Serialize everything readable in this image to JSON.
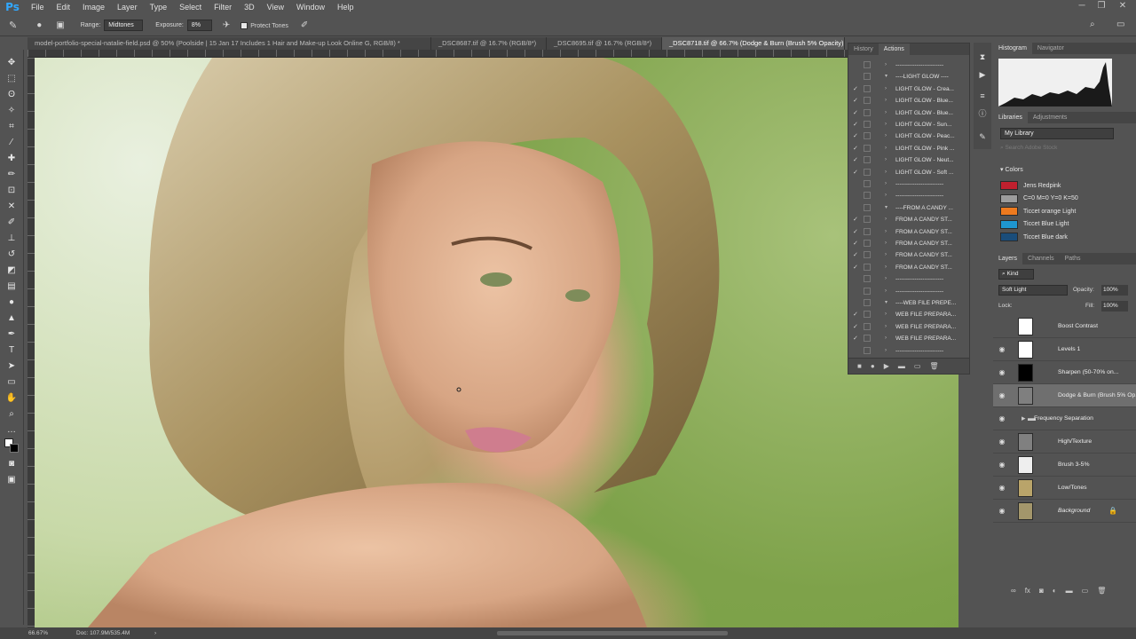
{
  "app": {
    "logo": "Ps"
  },
  "menu": [
    "File",
    "Edit",
    "Image",
    "Layer",
    "Type",
    "Select",
    "Filter",
    "3D",
    "View",
    "Window",
    "Help"
  ],
  "options": {
    "range_label": "Range:",
    "range_value": "Midtones",
    "exposure_label": "Exposure:",
    "exposure_value": "8%",
    "protect_tones": "Protect Tones"
  },
  "tabs": [
    {
      "label": "model-portfolio-special-natalie-field.psd @ 50% (Poolside | 15 Jan 17  Includes 1 Hair and Make-up Look Online G, RGB/8) *"
    },
    {
      "label": "_DSC8687.tif @ 16.7% (RGB/8*)"
    },
    {
      "label": "_DSC8695.tif @ 16.7% (RGB/8*)"
    },
    {
      "label": "_DSC8718.tif @ 66.7% (Dodge & Burn (Brush 5% Opacity), RGB/16*)"
    }
  ],
  "actions": {
    "tab_history": "History",
    "tab_actions": "Actions",
    "rows": [
      {
        "check": "",
        "label": "-------------------------",
        "open": false
      },
      {
        "check": "",
        "label": "----LIGHT GLOW ----",
        "open": true
      },
      {
        "check": "✓",
        "label": "LIGHT GLOW - Crea...",
        "open": false
      },
      {
        "check": "✓",
        "label": "LIGHT GLOW - Blue...",
        "open": false
      },
      {
        "check": "✓",
        "label": "LIGHT GLOW - Blue...",
        "open": false
      },
      {
        "check": "✓",
        "label": "LIGHT GLOW - Sun...",
        "open": false
      },
      {
        "check": "✓",
        "label": "LIGHT GLOW - Peac...",
        "open": false
      },
      {
        "check": "✓",
        "label": "LIGHT GLOW - Pink ...",
        "open": false
      },
      {
        "check": "✓",
        "label": "LIGHT GLOW - Neut...",
        "open": false
      },
      {
        "check": "✓",
        "label": "LIGHT GLOW - Soft ...",
        "open": false
      },
      {
        "check": "",
        "label": "-------------------------",
        "open": false
      },
      {
        "check": "",
        "label": "-------------------------",
        "open": false
      },
      {
        "check": "",
        "label": "----FROM A CANDY ...",
        "open": true
      },
      {
        "check": "✓",
        "label": "FROM A CANDY ST...",
        "open": false
      },
      {
        "check": "✓",
        "label": "FROM A CANDY ST...",
        "open": false
      },
      {
        "check": "✓",
        "label": "FROM A CANDY ST...",
        "open": false
      },
      {
        "check": "✓",
        "label": "FROM A CANDY ST...",
        "open": false
      },
      {
        "check": "✓",
        "label": "FROM A CANDY ST...",
        "open": false
      },
      {
        "check": "",
        "label": "-------------------------",
        "open": false
      },
      {
        "check": "",
        "label": "-------------------------",
        "open": false
      },
      {
        "check": "",
        "label": "----WEB FILE PREPE...",
        "open": true
      },
      {
        "check": "✓",
        "label": "WEB FILE PREPARA...",
        "open": false
      },
      {
        "check": "✓",
        "label": "WEB FILE PREPARA...",
        "open": false
      },
      {
        "check": "✓",
        "label": "WEB FILE PREPARA...",
        "open": false
      },
      {
        "check": "",
        "label": "-------------------------",
        "open": false
      }
    ]
  },
  "histogram": {
    "tab1": "Histogram",
    "tab2": "Navigator"
  },
  "libraries": {
    "tab1": "Libraries",
    "tab2": "Adjustments",
    "library": "My Library",
    "search_placeholder": "Search Adobe Stock",
    "colors_heading": "Colors",
    "colors": [
      {
        "name": "Jens Redpink",
        "hex": "#c0202e"
      },
      {
        "name": "C=0 M=0 Y=0 K=50",
        "hex": "#9c9c9c"
      },
      {
        "name": "Ticcet orange Light",
        "hex": "#ee7a1e"
      },
      {
        "name": "Ticcet Blue Light",
        "hex": "#1e96d0"
      },
      {
        "name": "Ticcet Blue dark",
        "hex": "#1a4d7a"
      }
    ]
  },
  "layers": {
    "tab1": "Layers",
    "tab2": "Channels",
    "tab3": "Paths",
    "kind": "Kind",
    "blend": "Soft Light",
    "opacity_label": "Opacity:",
    "opacity": "100%",
    "lock_label": "Lock:",
    "fill_label": "Fill:",
    "fill": "100%",
    "rows": [
      {
        "name": "Boost Contrast",
        "visible": false,
        "thumb": "#ffffff",
        "selected": false
      },
      {
        "name": "Levels 1",
        "visible": true,
        "thumb": "#ffffff",
        "selected": false
      },
      {
        "name": "Sharpen (50-70% on...",
        "visible": true,
        "thumb": "#000000",
        "selected": false
      },
      {
        "name": "Dodge & Burn (Brush 5% Op...",
        "visible": true,
        "thumb": "#7f7f7f",
        "selected": true
      },
      {
        "name": "Frequency Separation",
        "visible": true,
        "thumb": "",
        "selected": false
      },
      {
        "name": "High/Texture",
        "visible": true,
        "thumb": "#808080",
        "selected": false
      },
      {
        "name": "Brush 3-5%",
        "visible": true,
        "thumb": "#eeeeee",
        "selected": false
      },
      {
        "name": "Low/Tones",
        "visible": true,
        "thumb": "#b9a46a",
        "selected": false
      },
      {
        "name": "Background",
        "visible": true,
        "thumb": "#a3966b",
        "selected": false
      }
    ]
  },
  "status": {
    "zoom": "66.67%",
    "doc": "Doc: 107.9M/535.4M"
  }
}
